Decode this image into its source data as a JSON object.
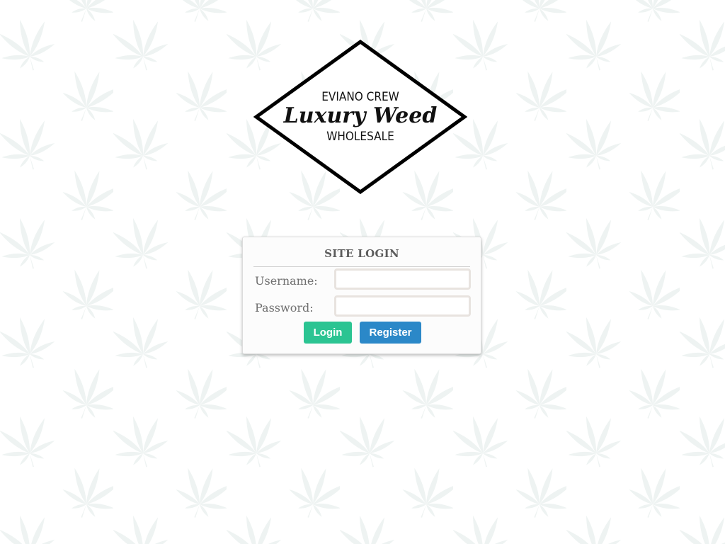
{
  "logo": {
    "line1": "EVIANO CREW",
    "line2": "Luxury Weed",
    "line3": "WHOLESALE",
    "icon": "diamond-logo"
  },
  "background": {
    "icon": "cannabis-leaf-pattern",
    "leaf_color": "#eef3f2"
  },
  "login": {
    "title": "SITE LOGIN",
    "username_label": "Username:",
    "password_label": "Password:",
    "username_value": "",
    "password_value": "",
    "login_label": "Login",
    "register_label": "Register"
  },
  "colors": {
    "login_button": "#2bc492",
    "register_button": "#2b88c8",
    "title_text": "#5c5c5c",
    "label_text": "#6f6f6f",
    "logo_stroke": "#000000"
  }
}
